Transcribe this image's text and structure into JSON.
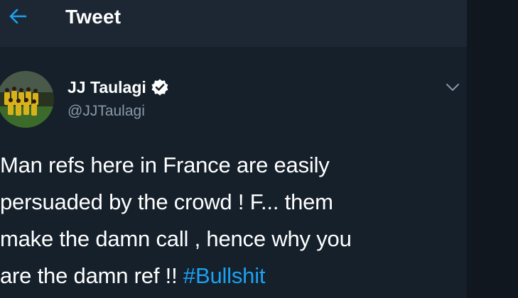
{
  "header": {
    "title": "Tweet",
    "back_icon": "arrow-left-icon"
  },
  "tweet": {
    "author": {
      "display_name": "JJ Taulagi",
      "handle": "@JJTaulagi",
      "verified": true,
      "verified_icon": "verified-badge-icon",
      "avatar": "avatar"
    },
    "menu_icon": "chevron-down-icon",
    "text_lines": [
      "Man refs here in France are easily",
      "persuaded by the crowd ! F... them",
      "make the damn call , hence why you",
      "are the damn ref !! "
    ],
    "hashtag": "#Bullshit"
  },
  "colors": {
    "background": "#15202b",
    "header_bg": "#1c2733",
    "accent": "#1da1f2",
    "secondary_text": "#8899a6",
    "primary_text": "#ffffff"
  }
}
